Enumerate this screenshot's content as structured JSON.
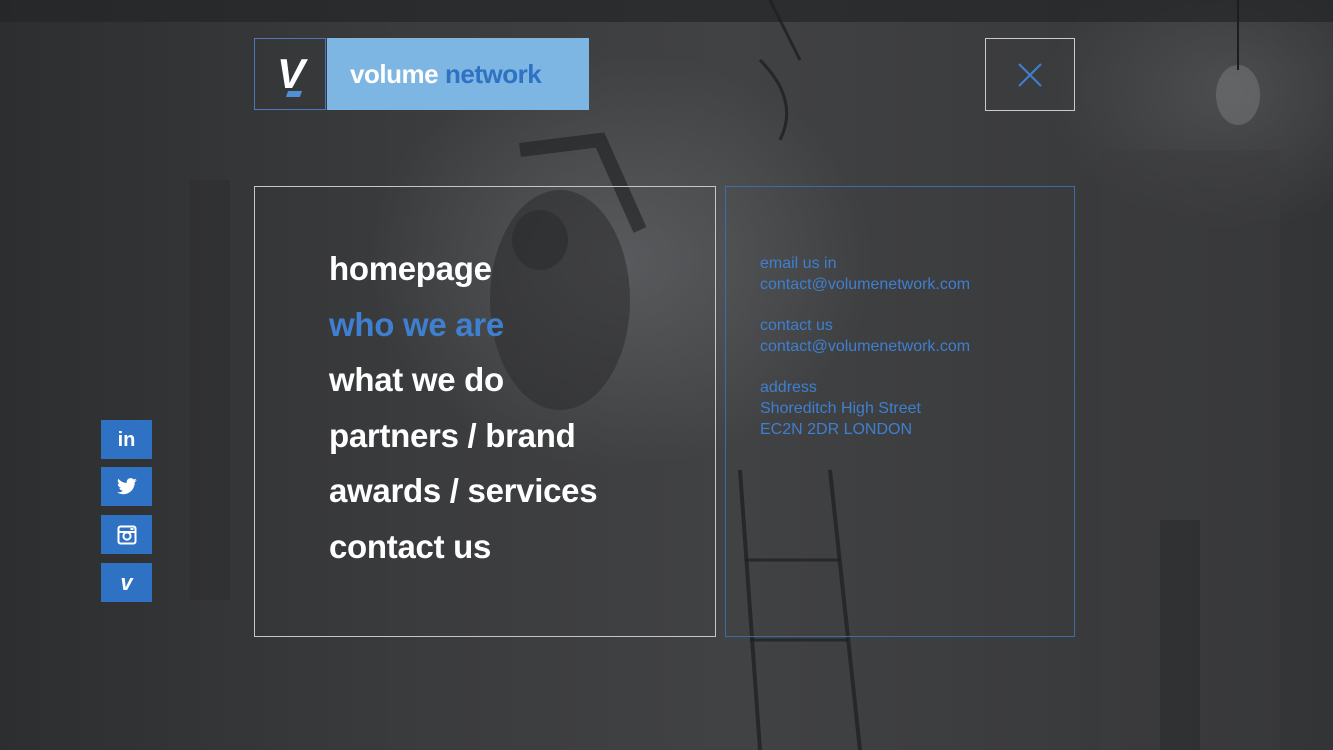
{
  "brand": {
    "logo_letter": "V",
    "name_part1": "volume",
    "name_part2": "network",
    "accent_color": "#7db6e3",
    "highlight_color": "#2f71c2"
  },
  "close_button": {
    "icon": "close-icon"
  },
  "menu": {
    "items": [
      {
        "label": "homepage",
        "active": false
      },
      {
        "label": "who we are",
        "active": true
      },
      {
        "label": "what we do",
        "active": false
      },
      {
        "label": "partners / brand",
        "active": false
      },
      {
        "label": "awards / services",
        "active": false
      },
      {
        "label": "contact us",
        "active": false
      }
    ],
    "active_color": "#3f7fd0"
  },
  "contact": {
    "email_label": "email us in",
    "email_value": "contact@volumenetwork.com",
    "contact_label": "contact us",
    "contact_value": "contact@volumenetwork.com",
    "address_label": "address",
    "address_line1": "Shoreditch High Street",
    "address_line2": "EC2N 2DR LONDON"
  },
  "social": {
    "linkedin": {
      "icon": "linkedin-icon",
      "glyph": "in"
    },
    "twitter": {
      "icon": "twitter-icon"
    },
    "instagram": {
      "icon": "instagram-icon"
    },
    "vimeo": {
      "icon": "vimeo-icon",
      "glyph": "v"
    }
  }
}
